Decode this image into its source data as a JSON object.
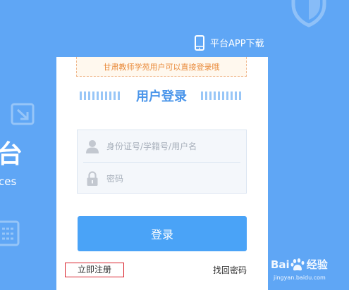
{
  "background": {
    "big_text": "台",
    "small_text": "ces"
  },
  "header": {
    "app_download_label": "平台APP下载"
  },
  "login": {
    "notice": "甘肃教师学苑用户可以直接登录哦",
    "title": "用户登录",
    "username_placeholder": "身份证号/学籍号/用户名",
    "password_placeholder": "密码",
    "submit_label": "登录",
    "register_label": "立即注册",
    "forgot_label": "找回密码"
  },
  "watermark": {
    "brand_left": "Bai",
    "brand_right": "经验",
    "url": "jingyan.baidu.com"
  },
  "colors": {
    "background": "#5fa6f5",
    "title_blue": "#4a95ea",
    "button_blue": "#4aa3f7",
    "notice_orange": "#e98a3a",
    "highlight_red": "#d9232d"
  },
  "icons": {
    "app": "phone-icon",
    "username": "user-icon",
    "password": "lock-icon"
  }
}
